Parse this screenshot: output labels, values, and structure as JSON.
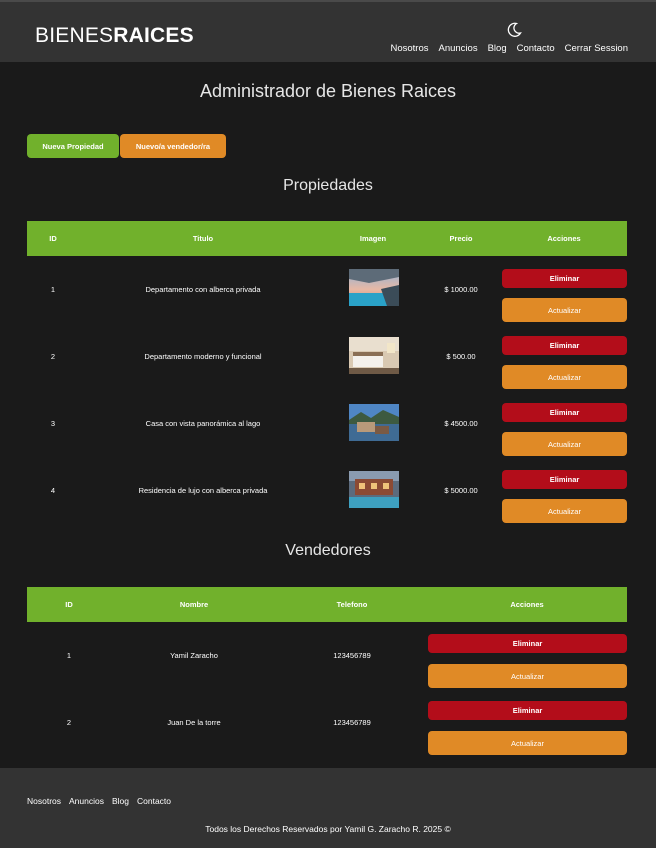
{
  "header": {
    "logo_light": "BIENES",
    "logo_bold": "RAICES",
    "theme_icon": "moon-icon",
    "nav": [
      "Nosotros",
      "Anuncios",
      "Blog",
      "Contacto",
      "Cerrar Session"
    ]
  },
  "main": {
    "title": "Administrador de Bienes Raices",
    "new_property_button": "Nueva Propiedad",
    "new_seller_button": "Nuevo/a vendedor/ra",
    "properties_title": "Propiedades",
    "properties_headers": [
      "ID",
      "Titulo",
      "Imagen",
      "Precio",
      "Acciones"
    ],
    "properties": [
      {
        "id": "1",
        "title": "Departamento con alberca privada",
        "image": "pool-apartment-photo",
        "price": "$ 1000.00"
      },
      {
        "id": "2",
        "title": "Departamento moderno y funcional",
        "image": "bedroom-photo",
        "price": "$ 500.00"
      },
      {
        "id": "3",
        "title": "Casa con vista panorámica al lago",
        "image": "lake-house-photo",
        "price": "$ 4500.00"
      },
      {
        "id": "4",
        "title": "Residencia de lujo con alberca privada",
        "image": "luxury-residence-photo",
        "price": "$ 5000.00"
      }
    ],
    "sellers_title": "Vendedores",
    "sellers_headers": [
      "ID",
      "Nombre",
      "Telefono",
      "Acciones"
    ],
    "sellers": [
      {
        "id": "1",
        "name": "Yamil Zaracho",
        "phone": "123456789"
      },
      {
        "id": "2",
        "name": "Juan De la torre",
        "phone": "123456789"
      }
    ],
    "delete_label": "Eliminar",
    "update_label": "Actualizar"
  },
  "footer": {
    "nav": [
      "Nosotros",
      "Anuncios",
      "Blog",
      "Contacto"
    ],
    "copyright": "Todos los Derechos Reservados por Yamil G. Zaracho R. 2025 ©"
  },
  "colors": {
    "background": "#1a1a1a",
    "header": "#333333",
    "green": "#71b12c",
    "orange": "#e08a26",
    "red": "#b30d1a"
  }
}
